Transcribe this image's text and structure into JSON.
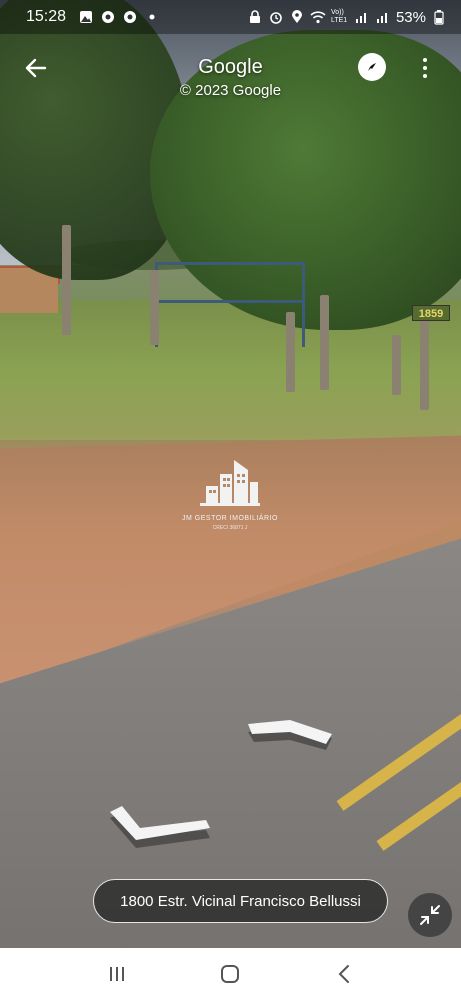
{
  "status_bar": {
    "time": "15:28",
    "left_icons": [
      "gallery-icon",
      "chrome-icon",
      "chrome-icon",
      "dot-icon"
    ],
    "right_icons": [
      "lock-icon",
      "alarm-icon",
      "location-icon",
      "wifi-icon",
      "volte-signal-icon",
      "signal-icon"
    ],
    "volte_label": "Vo)) LTE1",
    "battery": "53%"
  },
  "header": {
    "title": "Google",
    "subtitle": "© 2023 Google"
  },
  "scene": {
    "sign_number": "1859",
    "watermark_text": "JM GESTOR IMOBILIÁRIO",
    "watermark_sub": "CRECI 36871 J"
  },
  "address": "1800 Estr. Vicinal Francisco Bellussi",
  "colors": {
    "road_line": "#d7b44a",
    "gate": "#3c5a7a"
  }
}
